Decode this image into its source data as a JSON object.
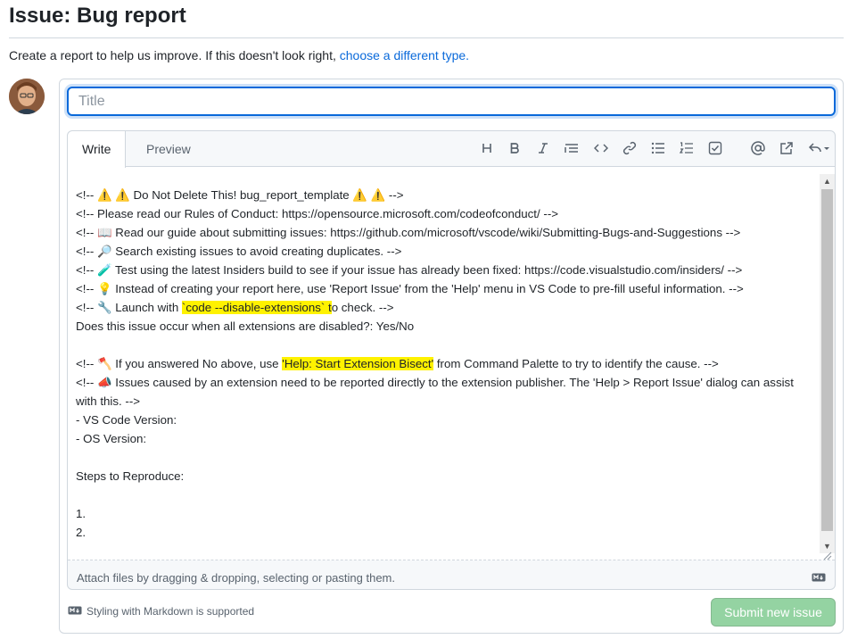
{
  "page": {
    "title": "Issue: Bug report",
    "intro_text": "Create a report to help us improve. If this doesn't look right, ",
    "intro_link": "choose a different type."
  },
  "form": {
    "title_placeholder": "Title",
    "tabs": [
      {
        "label": "Write",
        "active": true
      },
      {
        "label": "Preview",
        "active": false
      }
    ],
    "toolbar": [
      "heading-icon",
      "bold-icon",
      "italic-icon",
      "quote-icon",
      "code-icon",
      "link-icon",
      "unordered-list-icon",
      "ordered-list-icon",
      "task-list-icon",
      "mention-icon",
      "reference-icon",
      "undo-icon"
    ],
    "lines": [
      {
        "pre": "<!-- ⚠️ ⚠️ Do Not Delete This! bug_report_template ⚠️ ⚠️ -->"
      },
      {
        "pre": "<!-- Please read our Rules of Conduct: https://opensource.microsoft.com/codeofconduct/ -->"
      },
      {
        "pre": "<!-- 📖 Read our guide about submitting issues: https://github.com/microsoft/vscode/wiki/Submitting-Bugs-and-Suggestions -->"
      },
      {
        "pre": "<!-- 🔎 Search existing issues to avoid creating duplicates. -->"
      },
      {
        "pre": "<!-- 🧪 Test using the latest Insiders build to see if your issue has already been fixed: https://code.visualstudio.com/insiders/ -->"
      },
      {
        "pre": "<!-- 💡 Instead of creating your report here, use 'Report Issue' from the 'Help' menu in VS Code to pre-fill useful information. -->"
      },
      {
        "pre": "<!-- 🔧 Launch with ",
        "hl": "`code --disable-extensions` t",
        "post": "o check. -->"
      },
      {
        "pre": "Does this issue occur when all extensions are disabled?: Yes/No"
      },
      {
        "pre": ""
      },
      {
        "pre": "<!-- 🪓 If you answered No above, use ",
        "hl": "'Help: Start Extension Bisect'",
        "post": " from Command Palette to try to identify the cause. -->"
      },
      {
        "pre": "<!-- 📣 Issues caused by an extension need to be reported directly to the extension publisher. The 'Help > Report Issue' dialog can assist with this. -->"
      },
      {
        "pre": "- VS Code Version:"
      },
      {
        "pre": "- OS Version:"
      },
      {
        "pre": ""
      },
      {
        "pre": "Steps to Reproduce:"
      },
      {
        "pre": ""
      },
      {
        "pre": "1."
      },
      {
        "pre": "2."
      }
    ],
    "attach_text": "Attach files by dragging & dropping, selecting or pasting them.",
    "markdown_note": "Styling with Markdown is supported",
    "submit_label": "Submit new issue"
  },
  "colors": {
    "accent": "#0969da",
    "submit_disabled": "#94d3a2",
    "highlight": "#fff200"
  }
}
